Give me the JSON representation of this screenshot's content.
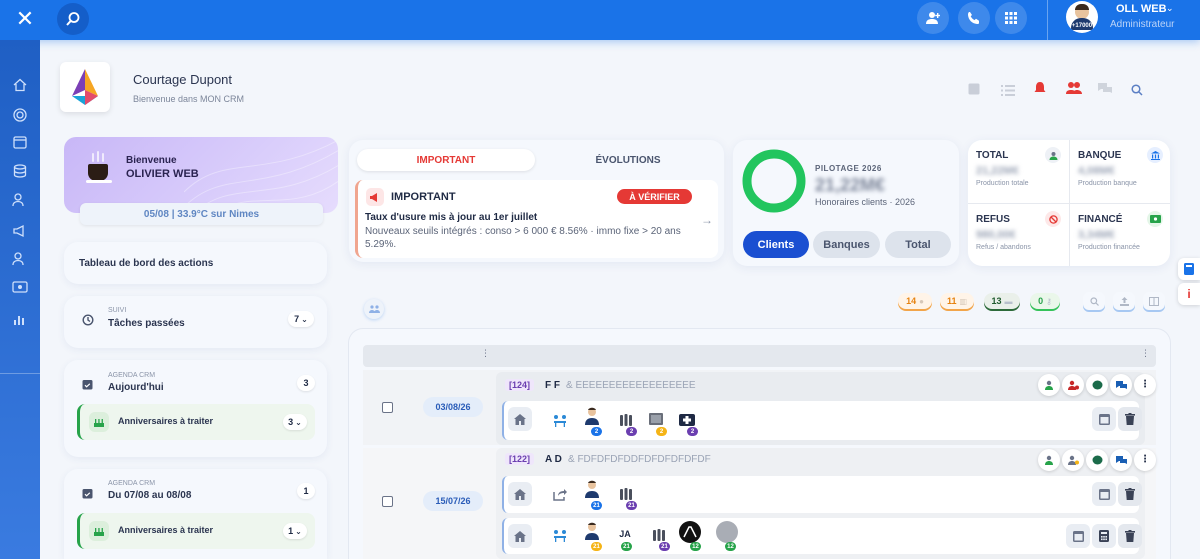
{
  "user": {
    "name": "OLL WEB",
    "role": "Administrateur",
    "avatar_badge": "+17000"
  },
  "company": {
    "name": "Courtage Dupont",
    "subtitle": "Bienvenue dans MON CRM"
  },
  "welcome": {
    "greeting": "Bienvenue",
    "name": "OLIVIER WEB",
    "weather": "05/08 | 33.9°C sur Nimes"
  },
  "dashboard": {
    "title": "Tableau de bord des actions"
  },
  "suivi": {
    "overline": "SUIVI",
    "title": "Tâches passées",
    "count": "7"
  },
  "agenda1": {
    "overline": "AGENDA CRM",
    "title": "Aujourd'hui",
    "count": "3",
    "sub_label": "Anniversaires à traiter",
    "sub_count": "3"
  },
  "agenda2": {
    "overline": "AGENDA CRM",
    "title": "Du 07/08 au 08/08",
    "count": "1",
    "sub_label": "Anniversaires à traiter",
    "sub_count": "1"
  },
  "news": {
    "tabs": [
      "IMPORTANT",
      "ÉVOLUTIONS"
    ],
    "header": "IMPORTANT",
    "badge": "À VÉRIFIER",
    "title": "Taux d'usure mis à jour au 1er juillet",
    "body": "Nouveaux seuils intégrés : conso > 6 000 € 8.56% · immo fixe > 20 ans 5.29%."
  },
  "pilotage": {
    "label": "PILOTAGE 2026",
    "amount": "21,22M€",
    "caption": "Honoraires clients · 2026",
    "tabs": [
      "Clients",
      "Banques",
      "Total"
    ]
  },
  "stats": [
    {
      "title": "TOTAL",
      "value": "21,22M€",
      "caption": "Production totale"
    },
    {
      "title": "BANQUE",
      "value": "4,08M€",
      "caption": "Production banque"
    },
    {
      "title": "REFUS",
      "value": "980,00€",
      "caption": "Refus / abandons"
    },
    {
      "title": "FINANCÉ",
      "value": "3,34M€",
      "caption": "Production financée"
    }
  ],
  "filters": [
    "14",
    "11",
    "13",
    "0"
  ],
  "rows": [
    {
      "id": "[124]",
      "initials": "F F",
      "name": "& EEEEEEEEEEEEEEEEEE",
      "date": "03/08/26",
      "counts": [
        "2",
        "2",
        "2",
        "2"
      ]
    },
    {
      "id": "[122]",
      "initials": "A D",
      "name": "& FDFDFDFDDFDFDFDFDFDF",
      "date": "15/07/26",
      "counts1": [
        "21",
        "21"
      ],
      "jalabel": "JA",
      "counts2": [
        "21",
        "21",
        "21",
        "12",
        "12"
      ]
    }
  ],
  "colors": {
    "primary": "#1a73e8",
    "danger": "#e53935",
    "success": "#22c55e",
    "purple": "#c7b6f5"
  }
}
